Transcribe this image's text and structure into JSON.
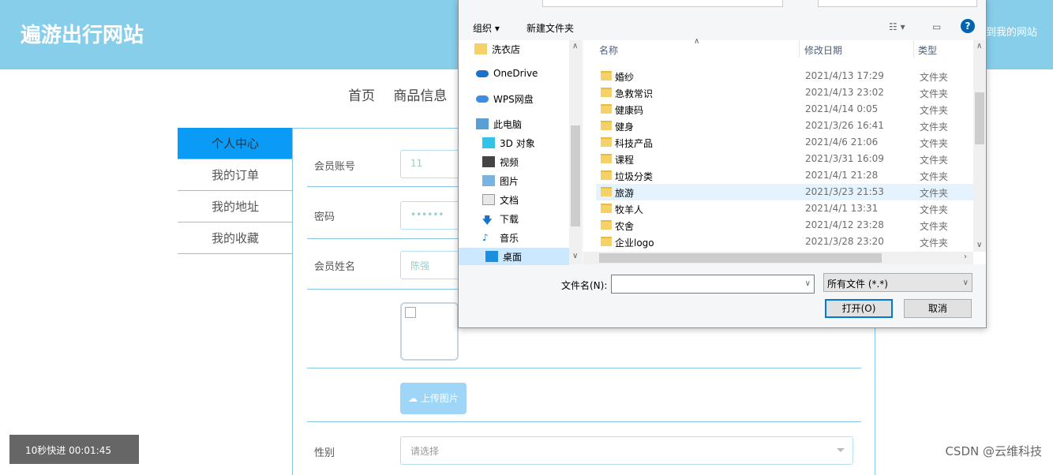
{
  "header": {
    "title": "遍游出行网站",
    "right_text": "到我的网站"
  },
  "topnav": [
    "首页",
    "商品信息"
  ],
  "sidebar": {
    "items": [
      {
        "label": "个人中心",
        "active": true
      },
      {
        "label": "我的订单"
      },
      {
        "label": "我的地址"
      },
      {
        "label": "我的收藏"
      }
    ]
  },
  "form": {
    "account_label": "会员账号",
    "account_value": "11",
    "password_label": "密码",
    "password_value": "••••••",
    "name_label": "会员姓名",
    "name_value": "陈强",
    "upload_label": "上传图片",
    "gender_label": "性别",
    "gender_placeholder": "请选择"
  },
  "dialog": {
    "toolbar": {
      "organize": "组织 ▾",
      "new_folder": "新建文件夹"
    },
    "nav": [
      {
        "label": "洗衣店",
        "icon": "folder-icon"
      },
      {
        "label": "OneDrive",
        "icon": "cloud-icon"
      },
      {
        "label": "WPS网盘",
        "icon": "cloud-icon"
      },
      {
        "label": "此电脑",
        "icon": "computer-icon"
      },
      {
        "label": "3D 对象",
        "icon": "cube-icon"
      },
      {
        "label": "视频",
        "icon": "video-icon"
      },
      {
        "label": "图片",
        "icon": "picture-icon"
      },
      {
        "label": "文档",
        "icon": "document-icon"
      },
      {
        "label": "下载",
        "icon": "download-icon"
      },
      {
        "label": "音乐",
        "icon": "music-icon"
      },
      {
        "label": "桌面",
        "icon": "desktop-icon"
      }
    ],
    "columns": {
      "name": "名称",
      "modified": "修改日期",
      "type": "类型"
    },
    "files": [
      {
        "name": "婚纱",
        "date": "2021/4/13 17:29",
        "type": "文件夹"
      },
      {
        "name": "急救常识",
        "date": "2021/4/13 23:02",
        "type": "文件夹"
      },
      {
        "name": "健康码",
        "date": "2021/4/14 0:05",
        "type": "文件夹"
      },
      {
        "name": "健身",
        "date": "2021/3/26 16:41",
        "type": "文件夹"
      },
      {
        "name": "科技产品",
        "date": "2021/4/6 21:06",
        "type": "文件夹"
      },
      {
        "name": "课程",
        "date": "2021/3/31 16:09",
        "type": "文件夹"
      },
      {
        "name": "垃圾分类",
        "date": "2021/4/1 21:28",
        "type": "文件夹"
      },
      {
        "name": "旅游",
        "date": "2021/3/23 21:53",
        "type": "文件夹"
      },
      {
        "name": "牧羊人",
        "date": "2021/4/1 13:31",
        "type": "文件夹"
      },
      {
        "name": "农舍",
        "date": "2021/4/12 23:28",
        "type": "文件夹"
      },
      {
        "name": "企业logo",
        "date": "2021/3/28 23:20",
        "type": "文件夹"
      }
    ],
    "filename_label": "文件名(N):",
    "filetype": "所有文件 (*.*)",
    "open": "打开(O)",
    "cancel": "取消"
  },
  "player": {
    "text": "10秒快进   00:01:45"
  },
  "watermark": "CSDN @云维科技"
}
